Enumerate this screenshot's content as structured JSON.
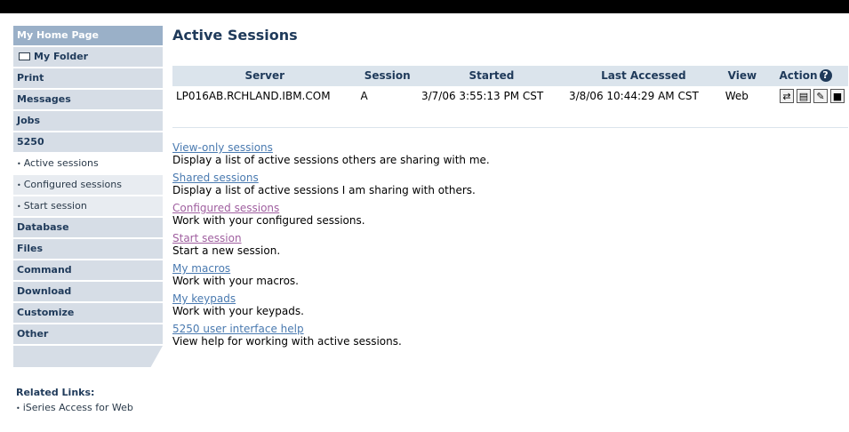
{
  "sidebar": {
    "home": "My Home Page",
    "folder": "My Folder",
    "print": "Print",
    "messages": "Messages",
    "jobs": "Jobs",
    "s5250": "5250",
    "active_sessions": "Active sessions",
    "configured_sessions": "Configured sessions",
    "start_session": "Start session",
    "database": "Database",
    "files": "Files",
    "command": "Command",
    "download": "Download",
    "customize": "Customize",
    "other": "Other",
    "related_title": "Related Links:",
    "related_link": "iSeries Access for Web"
  },
  "main": {
    "title": "Active Sessions",
    "table": {
      "headers": [
        "Server",
        "Session",
        "Started",
        "Last Accessed",
        "View",
        "Action"
      ],
      "rows": [
        [
          "LP016AB.RCHLAND.IBM.COM",
          "A",
          "3/7/06 3:55:13 PM CST",
          "3/8/06 10:44:29 AM CST",
          "Web"
        ]
      ]
    },
    "links": [
      {
        "label": "View-only sessions",
        "desc": "Display a list of active sessions others are sharing with me."
      },
      {
        "label": "Shared sessions",
        "desc": "Display a list of active sessions I am sharing with others."
      },
      {
        "label": "Configured sessions",
        "desc": "Work with your configured sessions."
      },
      {
        "label": "Start session",
        "desc": "Start a new session."
      },
      {
        "label": "My macros",
        "desc": "Work with your macros."
      },
      {
        "label": "My keypads",
        "desc": "Work with your keypads."
      },
      {
        "label": "5250 user interface help",
        "desc": "View help for working with active sessions."
      }
    ]
  },
  "colors": {
    "sidebar_home": "#9ab0c8",
    "sidebar_item": "#d6dde6",
    "title": "#1f3a5a",
    "link": "#4a7ab0",
    "visited_link": "#a060a0"
  },
  "icons": {
    "help": "question-circle-icon",
    "actions": [
      "transfer-icon",
      "share-icon",
      "edit-icon",
      "stop-icon"
    ]
  }
}
